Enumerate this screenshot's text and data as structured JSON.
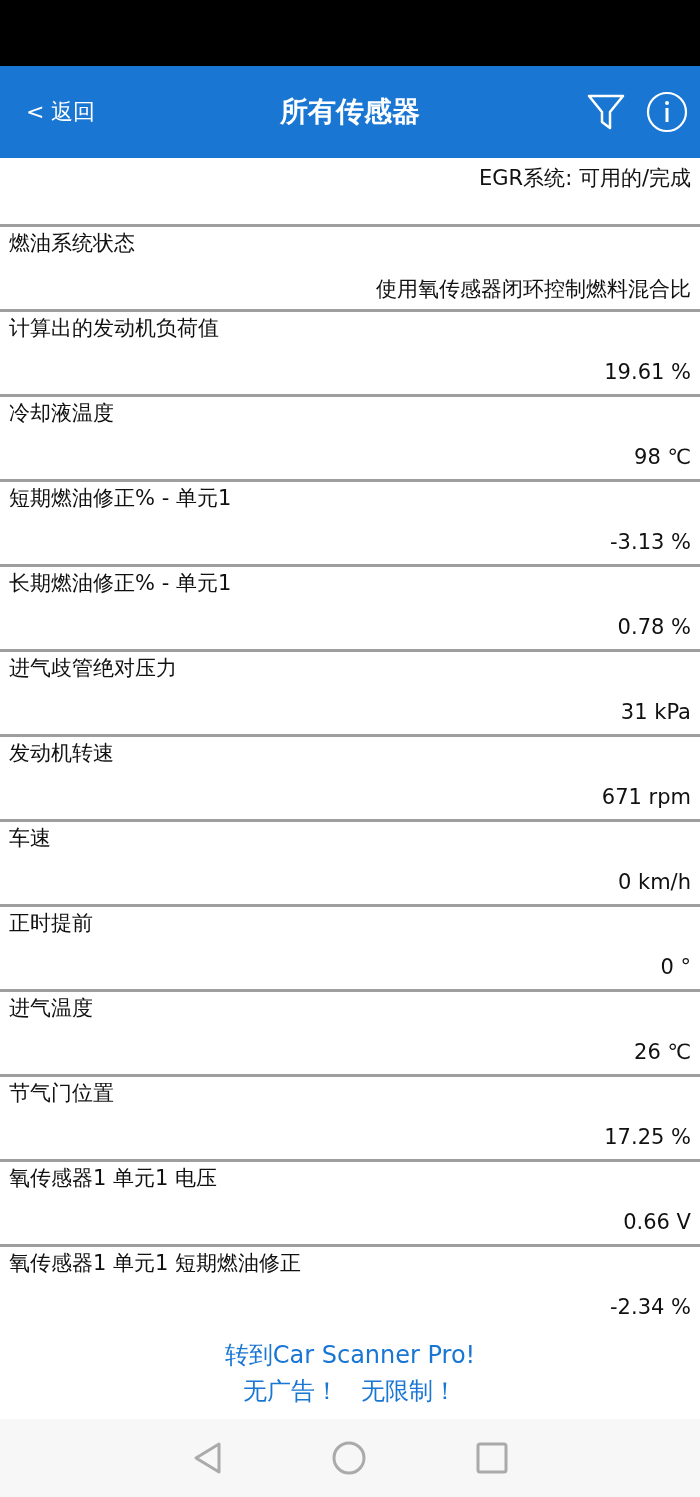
{
  "header": {
    "back": "< 返回",
    "title": "所有传感器"
  },
  "status_line": "EGR系统: 可用的/完成",
  "sensors": [
    {
      "name": "燃油系统状态",
      "value": "使用氧传感器闭环控制燃料混合比"
    },
    {
      "name": "计算出的发动机负荷值",
      "value": "19.61 %"
    },
    {
      "name": "冷却液温度",
      "value": "98 ℃"
    },
    {
      "name": "短期燃油修正% - 单元1",
      "value": "-3.13 %"
    },
    {
      "name": "长期燃油修正% - 单元1",
      "value": "0.78 %"
    },
    {
      "name": "进气歧管绝对压力",
      "value": "31 kPa"
    },
    {
      "name": "发动机转速",
      "value": "671 rpm"
    },
    {
      "name": "车速",
      "value": "0 km/h"
    },
    {
      "name": "正时提前",
      "value": "0 °"
    },
    {
      "name": "进气温度",
      "value": "26 ℃"
    },
    {
      "name": "节气门位置",
      "value": "17.25 %"
    },
    {
      "name": "氧传感器1 单元1 电压",
      "value": "0.66 V"
    },
    {
      "name": "氧传感器1 单元1 短期燃油修正",
      "value": "-2.34 %"
    }
  ],
  "promo": [
    "转到Car Scanner Pro!",
    "无广告！   无限制！"
  ]
}
